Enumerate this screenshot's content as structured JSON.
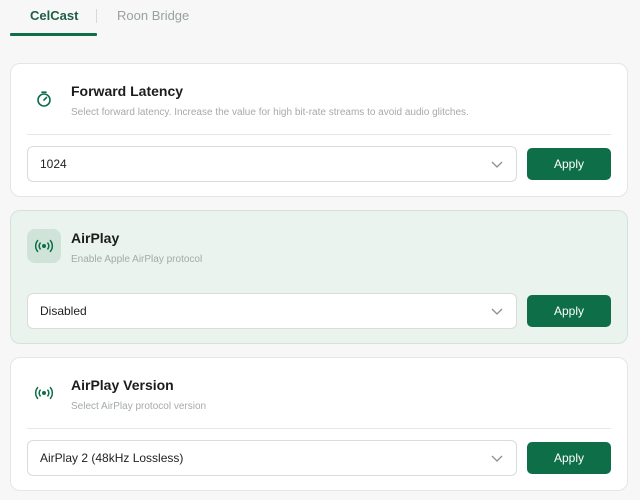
{
  "tabs": [
    {
      "label": "CelCast",
      "active": true
    },
    {
      "label": "Roon Bridge",
      "active": false
    }
  ],
  "colors": {
    "accent": "#0e6e48",
    "active_card_bg": "#eaf3ee"
  },
  "settings": [
    {
      "title": "Forward Latency",
      "description": "Select forward latency. Increase the value for high bit-rate streams to avoid audio glitches.",
      "icon": "timer-icon",
      "value": "1024",
      "apply_label": "Apply"
    },
    {
      "title": "AirPlay",
      "description": "Enable Apple AirPlay protocol",
      "icon": "broadcast-icon",
      "value": "Disabled",
      "apply_label": "Apply"
    },
    {
      "title": "AirPlay Version",
      "description": "Select AirPlay protocol version",
      "icon": "broadcast-icon",
      "value": "AirPlay 2 (48kHz Lossless)",
      "apply_label": "Apply"
    }
  ]
}
